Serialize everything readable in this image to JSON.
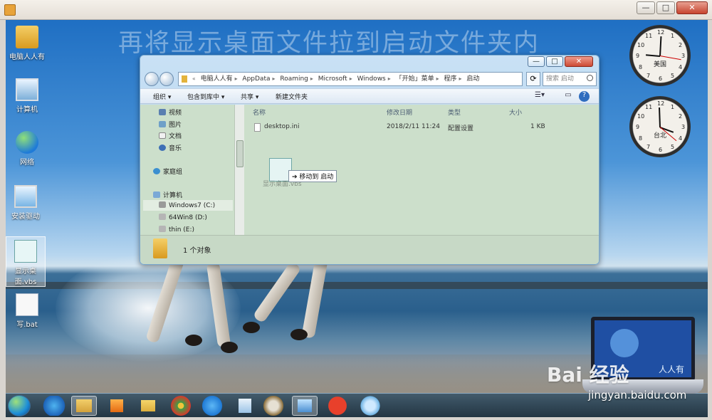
{
  "overlay_title": "再将显示桌面文件拉到启动文件夹内",
  "desktop_icons": [
    {
      "label": "电脑人人有",
      "icon": "folder-icon"
    },
    {
      "label": "计算机",
      "icon": "computer-icon"
    },
    {
      "label": "网络",
      "icon": "network-icon"
    },
    {
      "label": "安装驱动",
      "icon": "installer-icon"
    },
    {
      "label": "显示桌面.vbs",
      "icon": "vbs-script-icon"
    },
    {
      "label": "写.bat",
      "icon": "bat-file-icon"
    }
  ],
  "clocks": [
    {
      "city": "美国",
      "numbers": [
        "12",
        "1",
        "2",
        "3",
        "4",
        "5",
        "6",
        "7",
        "8",
        "9",
        "10",
        "11"
      ]
    },
    {
      "city": "台北",
      "numbers": [
        "12",
        "1",
        "2",
        "3",
        "4",
        "5",
        "6",
        "7",
        "8",
        "9",
        "10",
        "11"
      ]
    }
  ],
  "explorer": {
    "window_controls": [
      "—",
      "□",
      "✕"
    ],
    "address": {
      "prefix": "«",
      "segments": [
        "电脑人人有",
        "AppData",
        "Roaming",
        "Microsoft",
        "Windows",
        "「开始」菜单",
        "程序",
        "启动"
      ]
    },
    "search_placeholder": "搜索 启动",
    "toolbar": [
      "组织 ▾",
      "包含到库中 ▾",
      "共享 ▾",
      "新建文件夹"
    ],
    "nav_items": [
      {
        "label": "视频",
        "icon": "video-icon"
      },
      {
        "label": "图片",
        "icon": "pictures-icon"
      },
      {
        "label": "文档",
        "icon": "documents-icon"
      },
      {
        "label": "音乐",
        "icon": "music-icon"
      },
      {
        "label": "家庭组",
        "icon": "homegroup-icon"
      },
      {
        "label": "计算机",
        "icon": "computer-icon"
      },
      {
        "label": "Windows7 (C:)",
        "icon": "drive-icon"
      },
      {
        "label": "64Win8 (D:)",
        "icon": "drive-icon"
      },
      {
        "label": "thin (E:)",
        "icon": "drive-icon"
      }
    ],
    "columns": [
      "名称",
      "修改日期",
      "类型",
      "大小"
    ],
    "files": [
      {
        "name": "desktop.ini",
        "date": "2018/2/11 11:24",
        "type": "配置设置",
        "size": "1 KB"
      }
    ],
    "drag": {
      "label": "显示桌面.vbs",
      "tooltip": "➔ 移动到 启动"
    },
    "details_text": "1 个对象"
  },
  "watermark": {
    "brand": "Bai 经验",
    "url": "jingyan.baidu.com",
    "screen_text": "人人有"
  }
}
